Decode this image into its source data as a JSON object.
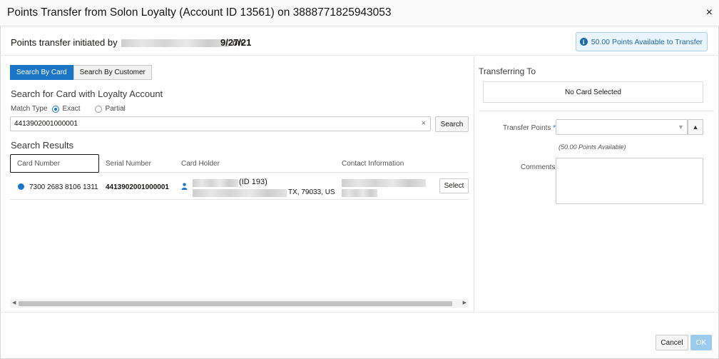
{
  "dialog": {
    "title": "Points Transfer from Solon Loyalty (Account ID 13561) on 3888771825943053",
    "close_glyph": "×"
  },
  "initiation": {
    "prefix": "Points transfer initiated by",
    "on_word": "on",
    "date": "9/27/21"
  },
  "points_badge": {
    "text": "50.00 Points Available to Transfer",
    "icon": "info-icon",
    "icon_glyph": "i"
  },
  "tabs": [
    {
      "label": "Search By Card",
      "active": true
    },
    {
      "label": "Search By Customer",
      "active": false
    }
  ],
  "search": {
    "heading": "Search for Card with Loyalty Account",
    "match_type_label": "Match Type",
    "options": [
      {
        "label": "Exact",
        "selected": true
      },
      {
        "label": "Partial",
        "selected": false
      }
    ],
    "value": "4413902001000001",
    "clear_glyph": "×",
    "button_label": "Search"
  },
  "results": {
    "heading": "Search Results",
    "columns": [
      "Card Number",
      "Serial Number",
      "Card Holder",
      "Contact Information"
    ],
    "rows": [
      {
        "card_number": "7300 2683 8106 1311",
        "serial_number": "4413902001000001",
        "holder_id": "(ID 193)",
        "holder_address": "TX, 79033, US",
        "select_label": "Select"
      }
    ]
  },
  "transfer": {
    "heading": "Transferring To",
    "no_card": "No Card Selected",
    "points_label": "Transfer Points",
    "required_mark": "*",
    "points_available": "(50.00 Points Available)",
    "comments_label": "Comments"
  },
  "footer": {
    "cancel_label": "Cancel",
    "ok_label": "OK"
  },
  "colors": {
    "accent": "#1a75c7",
    "ok_disabled": "#9ccbee"
  }
}
